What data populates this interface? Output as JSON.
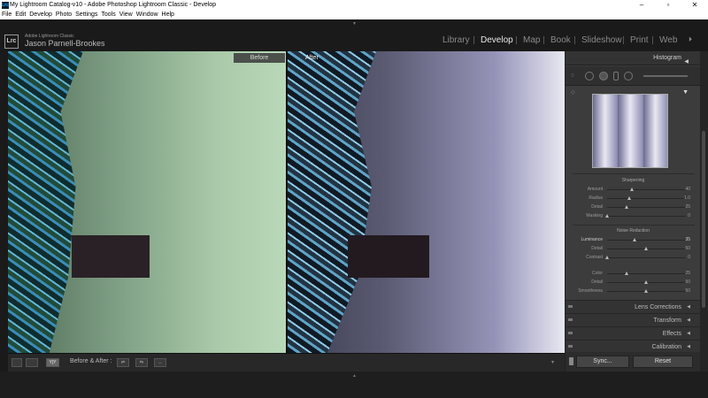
{
  "window": {
    "title": "My Lightroom Catalog-v10 - Adobe Photoshop Lightroom Classic - Develop",
    "app_icon": "Lrc",
    "minimize": "–",
    "maximize": "▫",
    "close": "✕"
  },
  "menu": [
    "File",
    "Edit",
    "Develop",
    "Photo",
    "Settings",
    "Tools",
    "View",
    "Window",
    "Help"
  ],
  "identity": {
    "logo": "Lrc",
    "product": "Adobe Lightroom Classic",
    "user": "Jason Parnell-Brookes"
  },
  "modules": [
    "Library",
    "Develop",
    "Map",
    "Book",
    "Slideshow",
    "Print",
    "Web"
  ],
  "active_module": "Develop",
  "viewer": {
    "before_label": "Before",
    "after_label": "After"
  },
  "toolbar": {
    "compare_label": "Before & After :"
  },
  "right_panel": {
    "histogram_title": "Histogram",
    "sharpening": {
      "title": "Sharpening",
      "sliders": [
        {
          "label": "Amount",
          "value": "40",
          "pos": 0.32
        },
        {
          "label": "Radius",
          "value": "1.0",
          "pos": 0.28
        },
        {
          "label": "Detail",
          "value": "25",
          "pos": 0.25
        },
        {
          "label": "Masking",
          "value": "0",
          "pos": 0.0
        }
      ]
    },
    "noise_reduction": {
      "title": "Noise Reduction",
      "sliders": [
        {
          "label": "Luminance",
          "value": "35",
          "pos": 0.35
        },
        {
          "label": "Detail",
          "value": "50",
          "pos": 0.5
        },
        {
          "label": "Contrast",
          "value": "0",
          "pos": 0.0
        },
        {
          "label": "Color",
          "value": "25",
          "pos": 0.25
        },
        {
          "label": "Detail",
          "value": "50",
          "pos": 0.5
        },
        {
          "label": "Smoothness",
          "value": "50",
          "pos": 0.5
        }
      ]
    },
    "collapsed_panels": [
      "Lens Corrections",
      "Transform",
      "Effects",
      "Calibration"
    ],
    "sync_label": "Sync...",
    "reset_label": "Reset"
  }
}
